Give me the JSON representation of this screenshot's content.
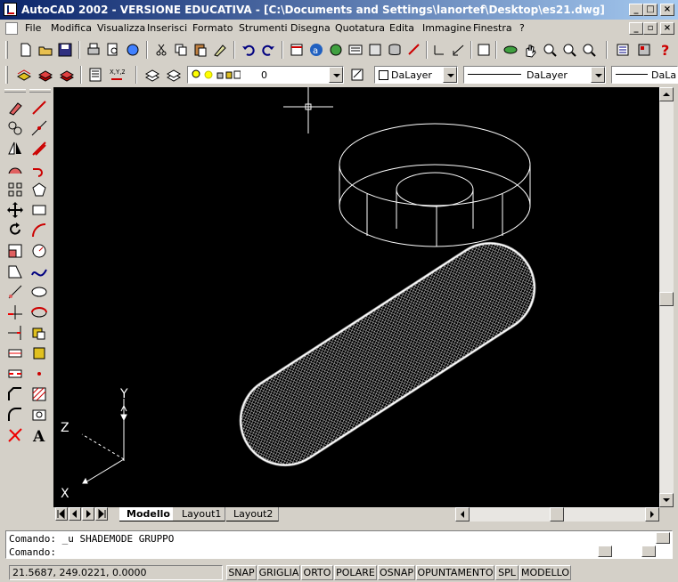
{
  "window": {
    "title": "AutoCAD 2002 - VERSIONE EDUCATIVA - [C:\\Documents and Settings\\lanortef\\Desktop\\es21.dwg]",
    "min_label": "_",
    "max_label": "□",
    "close_label": "×"
  },
  "menubar": {
    "items": [
      "File",
      "Modifica",
      "Visualizza",
      "Inserisci",
      "Formato",
      "Strumenti",
      "Disegna",
      "Quotatura",
      "Edita",
      "Immagine",
      "Finestra",
      "?"
    ]
  },
  "properties_toolbar": {
    "layer_value": "0",
    "color_value": "DaLayer",
    "linetype_value": "DaLayer",
    "lineweight_value": "DaLa"
  },
  "ucs": {
    "x_label": "X",
    "y_label": "Y",
    "z_label": "Z"
  },
  "layout_tabs": {
    "tabs": [
      "Modello",
      "Layout1",
      "Layout2"
    ],
    "active": "Modello"
  },
  "command": {
    "history_line": "Comando: _u SHADEMODE GRUPPO",
    "prompt_line": "Comando:"
  },
  "statusbar": {
    "coordinates": "21.5687, 249.0221, 0.0000",
    "toggles": [
      "SNAP",
      "GRIGLIA",
      "ORTO",
      "POLARE",
      "OSNAP",
      "OPUNTAMENTO",
      "SPL",
      "MODELLO"
    ]
  },
  "colors": {
    "titlebar_start": "#0a246a",
    "titlebar_end": "#a6caf0",
    "canvas": "#000000",
    "wireframe": "#ffffff",
    "chrome": "#d4d0c8"
  }
}
